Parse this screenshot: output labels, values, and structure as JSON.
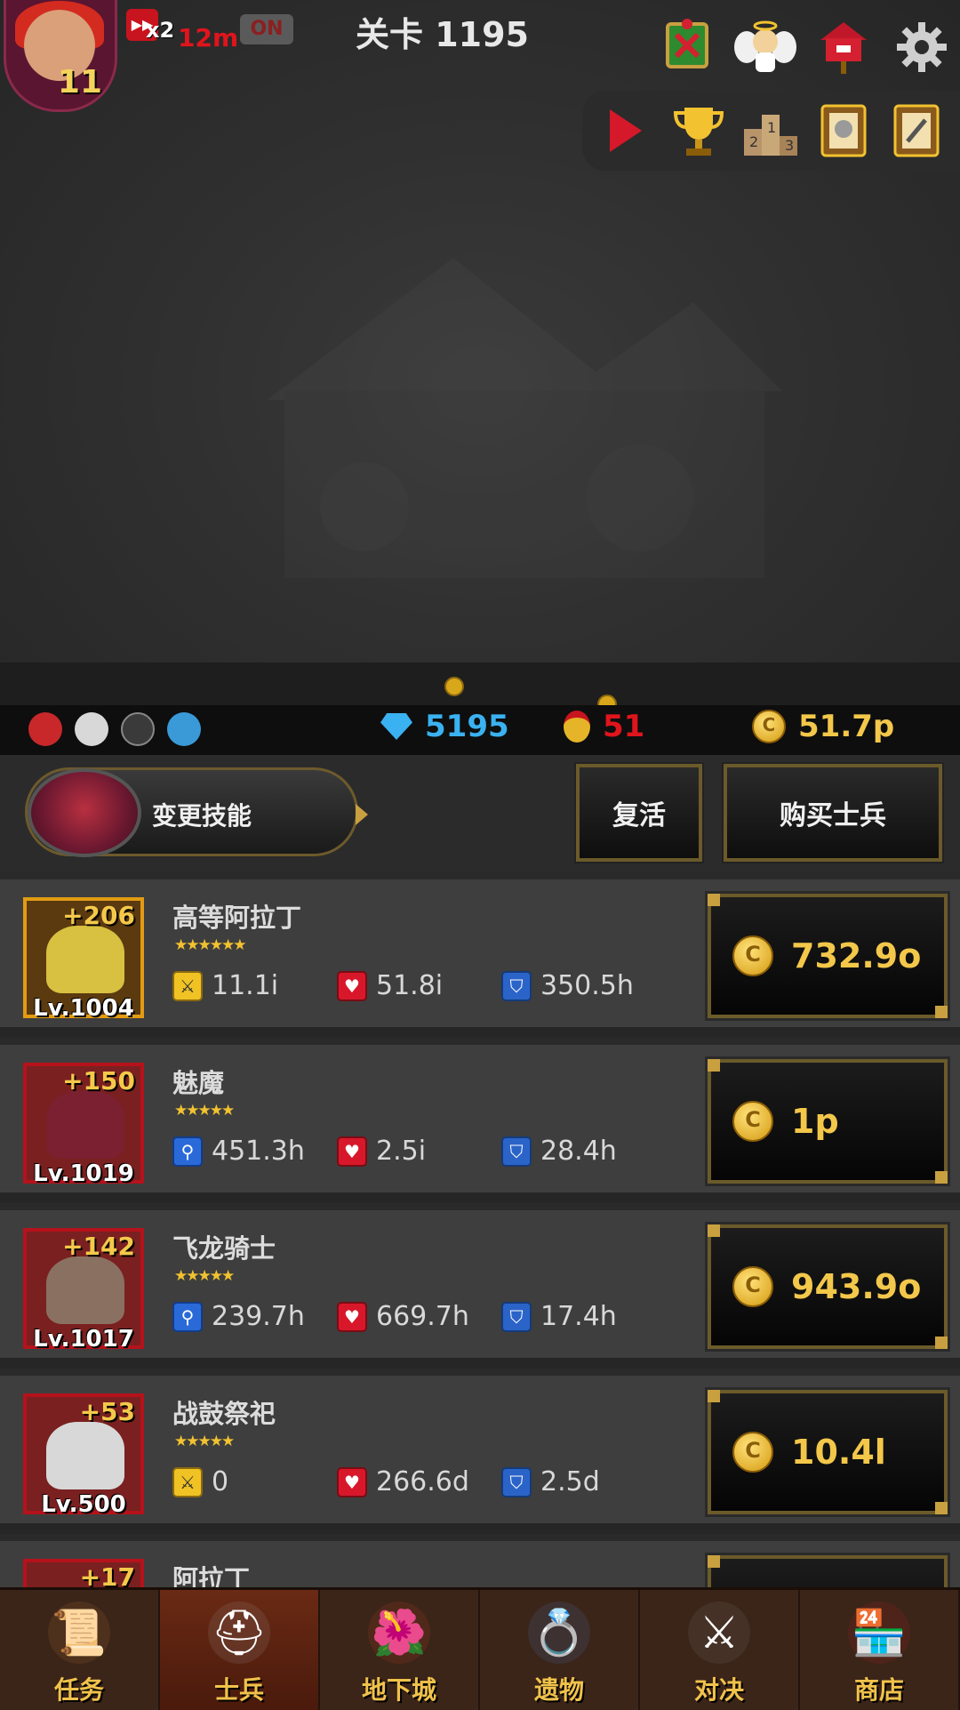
{
  "hud": {
    "player_level": "11",
    "speed_label": "x2",
    "speed_timer": "12m",
    "auto_toggle": "ON",
    "stage_title": "关卡 1195"
  },
  "top_icons": [
    "guild-banner-icon",
    "angel-icon",
    "mailbox-icon",
    "gear-icon"
  ],
  "icon_bar": [
    "play-icon",
    "trophy-icon",
    "podium-icon",
    "helmet-book-icon",
    "sword-book-icon"
  ],
  "currency": {
    "gems": "5195",
    "medals": "51",
    "gold": "51.7p"
  },
  "actions": {
    "change_skill": "变更技能",
    "revive": "复活",
    "buy_soldier": "购买士兵"
  },
  "units": [
    {
      "name": "高等阿拉丁",
      "plus": "+206",
      "level": "Lv.1004",
      "stars": "★★★★★★",
      "atk_type": "attack",
      "atk": "11.1i",
      "hp": "51.8i",
      "def": "350.5h",
      "price": "732.9o",
      "frame": "gold"
    },
    {
      "name": "魅魔",
      "plus": "+150",
      "level": "Lv.1019",
      "stars": "★★★★★",
      "atk_type": "magic",
      "atk": "451.3h",
      "hp": "2.5i",
      "def": "28.4h",
      "price": "1p",
      "frame": "red"
    },
    {
      "name": "飞龙骑士",
      "plus": "+142",
      "level": "Lv.1017",
      "stars": "★★★★★",
      "atk_type": "magic",
      "atk": "239.7h",
      "hp": "669.7h",
      "def": "17.4h",
      "price": "943.9o",
      "frame": "red"
    },
    {
      "name": "战鼓祭祀",
      "plus": "+53",
      "level": "Lv.500",
      "stars": "★★★★★",
      "atk_type": "attack",
      "atk": "0",
      "hp": "266.6d",
      "def": "2.5d",
      "price": "10.4l",
      "frame": "red"
    },
    {
      "name": "阿拉丁",
      "plus": "+17",
      "level": "",
      "stars": "",
      "atk_type": "attack",
      "atk": "",
      "hp": "",
      "def": "",
      "price": "",
      "frame": "red"
    }
  ],
  "nav": [
    {
      "label": "任务",
      "icon": "scroll-icon"
    },
    {
      "label": "士兵",
      "icon": "knight-icon"
    },
    {
      "label": "地下城",
      "icon": "monster-plant-icon"
    },
    {
      "label": "遗物",
      "icon": "orb-ring-icon"
    },
    {
      "label": "对决",
      "icon": "crossed-swords-icon"
    },
    {
      "label": "商店",
      "icon": "shop-icon"
    }
  ],
  "colors": {
    "gold_text": "#f3c74a",
    "gem_text": "#3ab1f0",
    "medal_text": "#e0141c",
    "nav_bg": "#3b2418"
  }
}
